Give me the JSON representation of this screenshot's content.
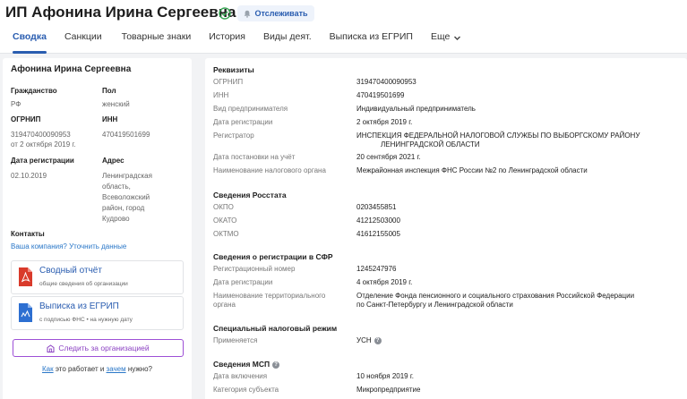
{
  "header": {
    "title": "ИП Афонина Ирина Сергеевна",
    "track_label": "Отслеживать",
    "tabs": [
      {
        "label": "Сводка"
      },
      {
        "label": "Санкции"
      },
      {
        "label": "Товарные знаки"
      },
      {
        "label": "История"
      },
      {
        "label": "Виды деят."
      },
      {
        "label": "Выписка из ЕГРИП"
      },
      {
        "label": "Еще"
      }
    ]
  },
  "left": {
    "name": "Афонина Ирина Сергеевна",
    "citizenship_label": "Гражданство",
    "citizenship_value": "РФ",
    "sex_label": "Пол",
    "sex_value": "женский",
    "ogrnip_label": "ОГРНИП",
    "ogrnip_value": "319470400090953",
    "ogrnip_date": "от 2 октября 2019 г.",
    "inn_label": "ИНН",
    "inn_value": "470419501699",
    "regdate_label": "Дата регистрации",
    "regdate_value": "02.10.2019",
    "address_label": "Адрес",
    "address_lines": [
      "Ленинградская",
      "область,",
      "Всеволожский",
      "район, город",
      "Кудрово"
    ],
    "contacts_label": "Контакты",
    "contacts_link": "Ваша компания? Уточнить данные",
    "report_title": "Сводный отчёт",
    "report_sub": "общие сведения об организации",
    "extract_title": "Выписка из ЕГРИП",
    "extract_sub": "с подписью ФНС • на нужную дату",
    "follow_label": "Следить за организацией",
    "how_a": "Как",
    "how_b": " это работает и ",
    "how_c": "зачем",
    "how_d": " нужно?"
  },
  "right": {
    "rekv_title": "Реквизиты",
    "rekv": [
      {
        "label": "ОГРНИП",
        "value": "319470400090953"
      },
      {
        "label": "ИНН",
        "value": "470419501699"
      },
      {
        "label": "Вид предпринимателя",
        "value": "Индивидуальный предприниматель"
      },
      {
        "label": "Дата регистрации",
        "value": "2 октября 2019 г."
      },
      {
        "label": "Регистратор",
        "value": "ИНСПЕКЦИЯ ФЕДЕРАЛЬНОЙ НАЛОГОВОЙ СЛУЖБЫ ПО ВЫБОРГСКОМУ РАЙОНУ",
        "value2": "ЛЕНИНГРАДСКОЙ ОБЛАСТИ"
      },
      {
        "label": "Дата постановки на учёт",
        "value": "20 сентября 2021 г."
      },
      {
        "label": "Наименование налогового органа",
        "value": "Межрайонная инспекция ФНС России №2 по Ленинградской области"
      }
    ],
    "rosstat_title": "Сведения Росстата",
    "rosstat": [
      {
        "label": "ОКПО",
        "value": "0203455851"
      },
      {
        "label": "ОКАТО",
        "value": "41212503000"
      },
      {
        "label": "ОКТМО",
        "value": "41612155005"
      }
    ],
    "sfr_title": "Сведения о регистрации в СФР",
    "sfr": [
      {
        "label": "Регистрационный номер",
        "value": "1245247976"
      },
      {
        "label": "Дата регистрации",
        "value": "4 октября 2019 г."
      },
      {
        "label": "Наименование территориального",
        "label2": "органа",
        "value": "Отделение Фонда пенсионного и социального страхования Российской Федерации",
        "value2": "по Санкт-Петербургу и Ленинградской области"
      }
    ],
    "tax_title": "Специальный налоговый режим",
    "tax_label": "Применяется",
    "tax_value": "УСН",
    "msp_title": "Сведения МСП",
    "msp": [
      {
        "label": "Дата включения",
        "value": "10 ноября 2019 г."
      },
      {
        "label": "Категория субъекта",
        "value": "Микропредприятие"
      }
    ]
  }
}
